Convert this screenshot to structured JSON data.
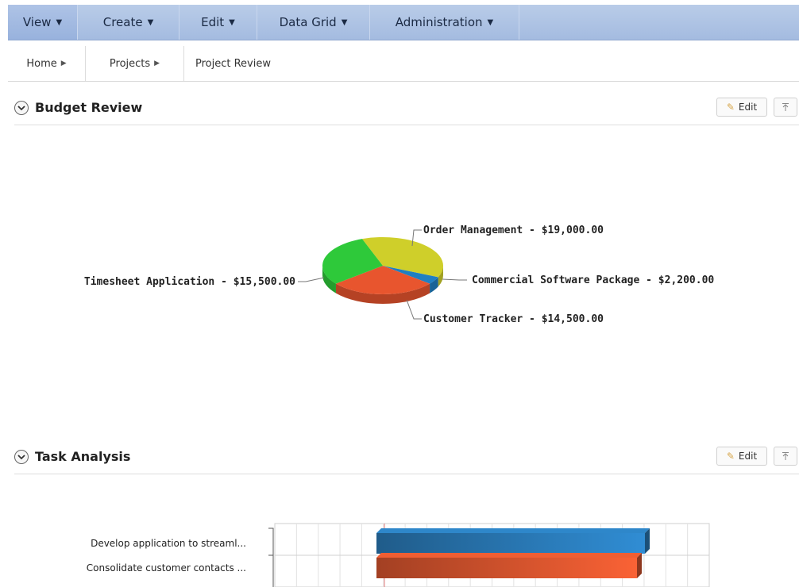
{
  "menu": {
    "items": [
      {
        "label": "View",
        "name": "menu-view"
      },
      {
        "label": "Create",
        "name": "menu-create"
      },
      {
        "label": "Edit",
        "name": "menu-edit"
      },
      {
        "label": "Data Grid",
        "name": "menu-data-grid"
      },
      {
        "label": "Administration",
        "name": "menu-administration"
      }
    ]
  },
  "breadcrumb": {
    "items": [
      "Home",
      "Projects",
      "Project Review"
    ]
  },
  "regions": {
    "budget": {
      "title": "Budget Review",
      "edit_label": "Edit"
    },
    "tasks": {
      "title": "Task Analysis",
      "edit_label": "Edit"
    }
  },
  "chart_data": [
    {
      "type": "pie",
      "title": "",
      "slices": [
        {
          "label": "Order Management - $19,000.00",
          "value": 19000,
          "color": "#cfcf2a"
        },
        {
          "label": "Commercial Software Package - $2,200.00",
          "value": 2200,
          "color": "#1f7fc2"
        },
        {
          "label": "Customer Tracker - $14,500.00",
          "value": 14500,
          "color": "#e8552e"
        },
        {
          "label": "Timesheet Application - $15,500.00",
          "value": 15500,
          "color": "#2ec93a"
        }
      ]
    },
    {
      "type": "bar",
      "title": "",
      "categories": [
        "Develop application to streaml...",
        "Consolidate customer contacts ..."
      ],
      "series": [
        {
          "colors": [
            "#2a7bb8",
            "#d9552e"
          ]
        }
      ]
    }
  ]
}
